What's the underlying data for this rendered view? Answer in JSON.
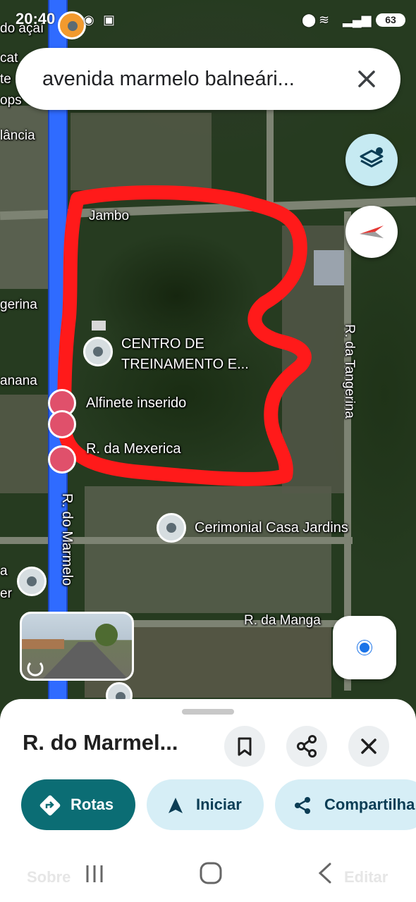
{
  "status_bar": {
    "time": "20:40",
    "battery": "63"
  },
  "search": {
    "query": "avenida marmelo balneári..."
  },
  "map": {
    "street_labels": {
      "jambo": "Jambo",
      "tangerina_left": "gerina",
      "banana": "anana",
      "mexerica": "R. da Mexerica",
      "marmelo": "R. do Marmelo",
      "tangerina": "R. da Tangerina",
      "manga": "R. da Manga",
      "acai": "do açaí",
      "left_fragment_1": "cat",
      "left_fragment_2": "te",
      "left_fragment_3": "ops",
      "left_fragment_4": "lância",
      "left_fragment_5": "a",
      "left_fragment_6": "er"
    },
    "places": {
      "training_center": "CENTRO DE\nTREINAMENTO E...",
      "inserted_pin": "Alfinete inserido",
      "ceremonial": "Cerimonial Casa Jardins"
    },
    "colors": {
      "highlight_road": "#2f6bff",
      "annotation": "#ff1a1a"
    }
  },
  "sheet": {
    "title": "R. do Marmel...",
    "actions": {
      "routes": "Rotas",
      "start": "Iniciar",
      "share": "Compartilha"
    }
  },
  "nav_bar": {
    "left_ghost": "Sobre",
    "right_ghost": "Editar"
  }
}
